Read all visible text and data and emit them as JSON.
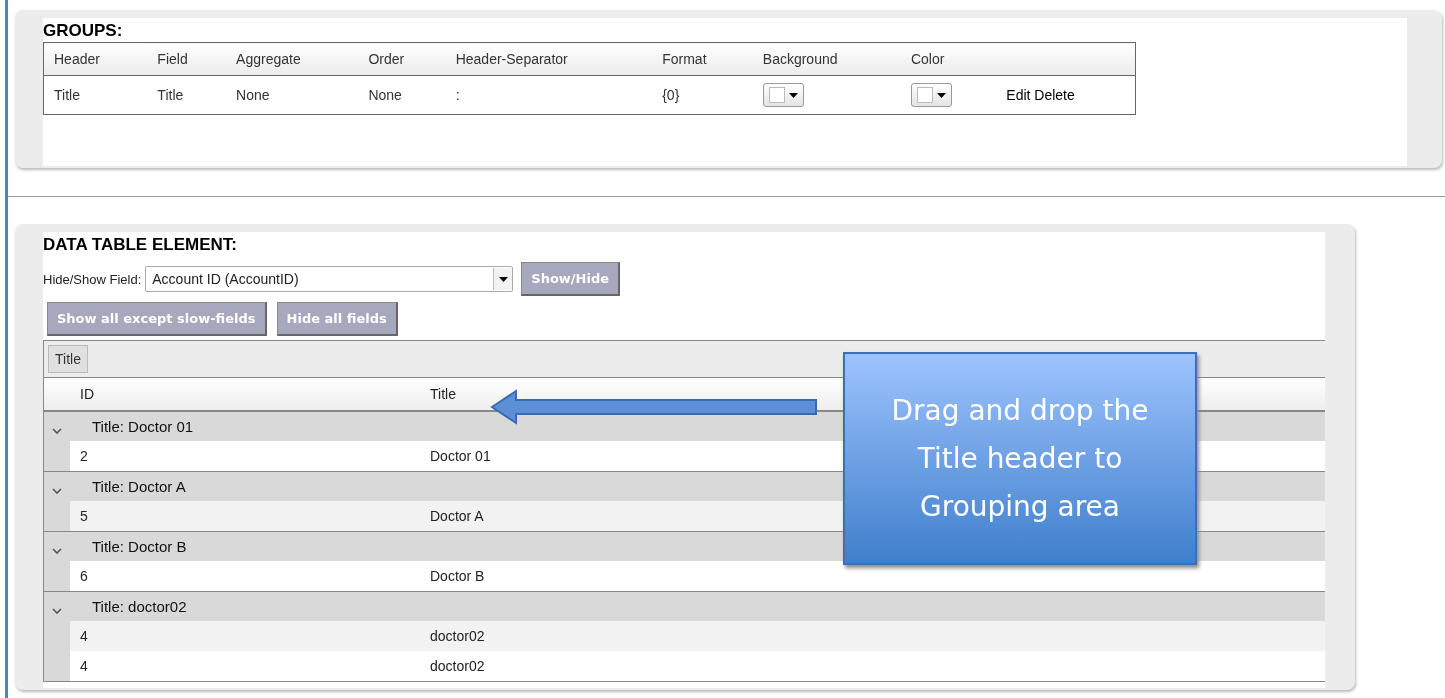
{
  "groups": {
    "title": "GROUPS:",
    "columns": [
      "Header",
      "Field",
      "Aggregate",
      "Order",
      "Header-Separator",
      "Format",
      "Background",
      "Color"
    ],
    "rows": [
      {
        "cells": [
          "Title",
          "Title",
          "None",
          "None",
          ":",
          "{0}"
        ],
        "actions": [
          "Edit",
          "Delete"
        ]
      }
    ]
  },
  "data_table": {
    "title": "DATA TABLE ELEMENT:",
    "field_label": "Hide/Show Field:",
    "field_value": "Account ID (AccountID)",
    "show_hide_button": "Show/Hide",
    "buttons": [
      "Show all except slow-fields",
      "Hide all fields"
    ],
    "group_by": [
      "Title"
    ],
    "columns": [
      "ID",
      "Title"
    ],
    "groups": [
      {
        "label": "Title: Doctor 01",
        "expanded": true,
        "rows": [
          [
            "2",
            "Doctor 01"
          ]
        ]
      },
      {
        "label": "Title: Doctor A",
        "expanded": true,
        "rows": [
          [
            "5",
            "Doctor A"
          ]
        ]
      },
      {
        "label": "Title: Doctor B",
        "expanded": true,
        "rows": [
          [
            "6",
            "Doctor B"
          ]
        ]
      },
      {
        "label": "Title: doctor02",
        "expanded": true,
        "rows": [
          [
            "4",
            "doctor02"
          ],
          [
            "4",
            "doctor02"
          ]
        ]
      }
    ]
  },
  "callout": {
    "text": "Drag and drop the Title header to Grouping area"
  }
}
